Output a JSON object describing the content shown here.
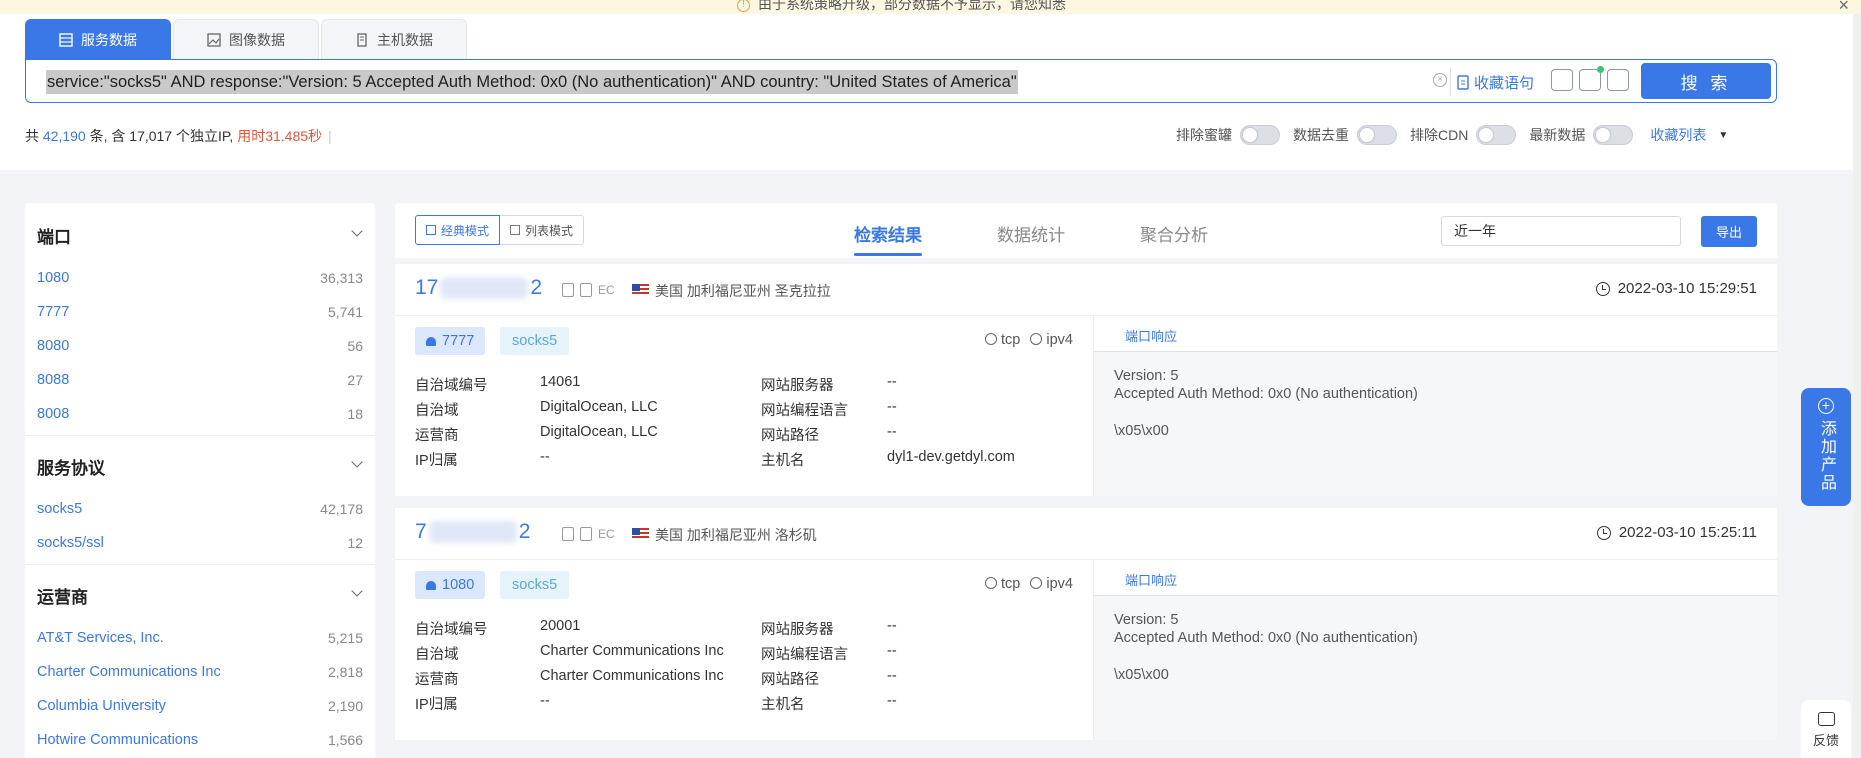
{
  "banner": {
    "text": "由于系统策略升级，部分数据不予显示，请您知悉"
  },
  "tabs": [
    {
      "label": "服务数据",
      "icon": "table-icon",
      "active": true
    },
    {
      "label": "图像数据",
      "icon": "image-icon",
      "active": false
    },
    {
      "label": "主机数据",
      "icon": "server-icon",
      "active": false
    }
  ],
  "search": {
    "query": "service:\"socks5\" AND response:\"Version: 5 Accepted Auth Method: 0x0 (No authentication)\" AND country: \"United States of America\"",
    "fav_label": "收藏语句",
    "button_label": "搜 索"
  },
  "stats": {
    "prefix": "共",
    "total": "42,190",
    "mid": "条, 含 17,017 个独立IP,",
    "time": "用时31.485秒"
  },
  "toggles": [
    {
      "label": "排除蜜罐",
      "on": false
    },
    {
      "label": "数据去重",
      "on": false
    },
    {
      "label": "排除CDN",
      "on": false
    },
    {
      "label": "最新数据",
      "on": false
    }
  ],
  "fav_list": "收藏列表",
  "sidebar": {
    "port": {
      "title": "端口",
      "items": [
        {
          "label": "1080",
          "count": "36,313"
        },
        {
          "label": "7777",
          "count": "5,741"
        },
        {
          "label": "8080",
          "count": "56"
        },
        {
          "label": "8088",
          "count": "27"
        },
        {
          "label": "8008",
          "count": "18"
        }
      ]
    },
    "protocol": {
      "title": "服务协议",
      "items": [
        {
          "label": "socks5",
          "count": "42,178"
        },
        {
          "label": "socks5/ssl",
          "count": "12"
        }
      ]
    },
    "isp": {
      "title": "运营商",
      "items": [
        {
          "label": "AT&T Services, Inc.",
          "count": "5,215"
        },
        {
          "label": "Charter Communications Inc",
          "count": "2,818"
        },
        {
          "label": "Columbia University",
          "count": "2,190"
        },
        {
          "label": "Hotwire Communications",
          "count": "1,566"
        }
      ]
    }
  },
  "result_head": {
    "mode_classic": "经典模式",
    "mode_list": "列表模式",
    "tabs": [
      "检索结果",
      "数据统计",
      "聚合分析"
    ],
    "range": "近一年",
    "export": "导出"
  },
  "labels": {
    "asn": "自治域编号",
    "as": "自治域",
    "isp": "运营商",
    "ip_owner": "IP归属",
    "web_server": "网站服务器",
    "web_lang": "网站编程语言",
    "web_path": "网站路径",
    "hostname": "主机名",
    "resp_tab": "端口响应",
    "tcp": "tcp",
    "ipv4": "ipv4",
    "ec": "EC"
  },
  "results": [
    {
      "ip_start": "17",
      "ip_end": "2",
      "location": "美国 加利福尼亚州 圣克拉拉",
      "time": "2022-03-10 15:29:51",
      "port": "7777",
      "service": "socks5",
      "asn": "14061",
      "as": "DigitalOcean, LLC",
      "isp": "DigitalOcean, LLC",
      "ip_owner": "--",
      "web_server": "--",
      "web_lang": "--",
      "web_path": "--",
      "hostname": "dyl1-dev.getdyl.com",
      "resp_line1": "Version: 5",
      "resp_line2": "Accepted Auth Method: 0x0 (No authentication)",
      "resp_line3": "\\x05\\x00"
    },
    {
      "ip_start": "7",
      "ip_end": "2",
      "location": "美国 加利福尼亚州 洛杉矶",
      "time": "2022-03-10 15:25:11",
      "port": "1080",
      "service": "socks5",
      "asn": "20001",
      "as": "Charter Communications Inc",
      "isp": "Charter Communications Inc",
      "ip_owner": "--",
      "web_server": "--",
      "web_lang": "--",
      "web_path": "--",
      "hostname": "--",
      "resp_line1": "Version: 5",
      "resp_line2": "Accepted Auth Method: 0x0 (No authentication)",
      "resp_line3": "\\x05\\x00"
    }
  ],
  "float": {
    "add_product": "添加产品",
    "feedback": "反馈"
  }
}
